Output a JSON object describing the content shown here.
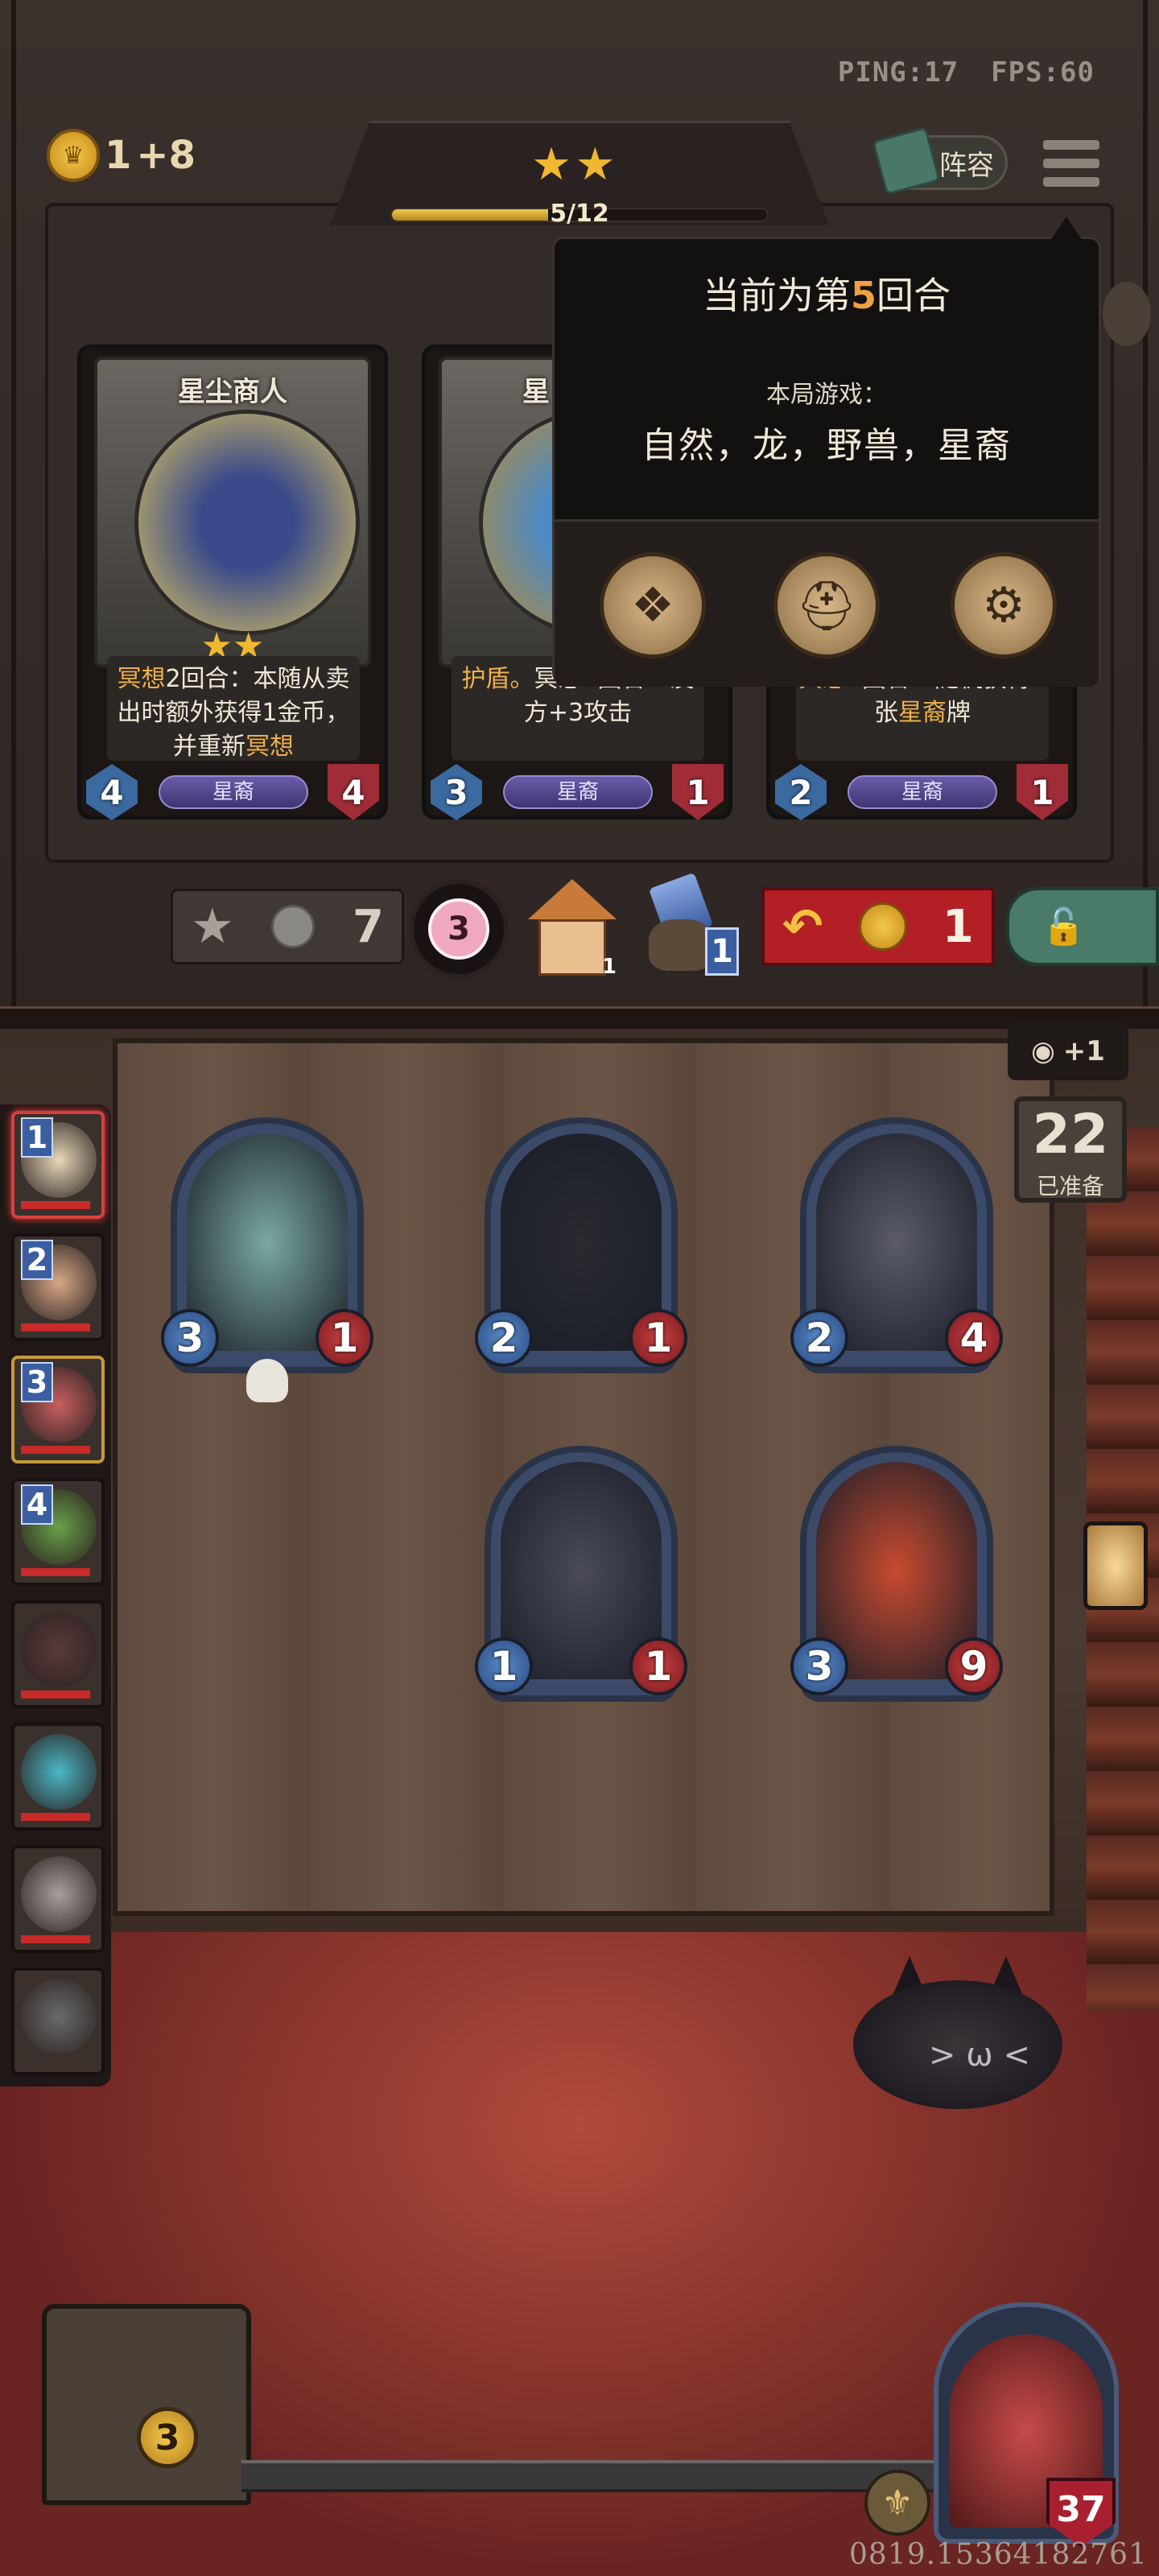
{
  "status": {
    "ping": "PING:17",
    "fps": "FPS:60"
  },
  "gold": {
    "amount": "1",
    "income": "+8"
  },
  "tier": {
    "stars": "★★",
    "progress_text": "5/12",
    "progress": 0.4167
  },
  "lineup_button": {
    "label": "阵容"
  },
  "shop_cards": [
    {
      "name": "星尘商人",
      "stars": "★★",
      "desc_pre": "冥想",
      "desc_mid": "2回合：本随从卖出时额外获得1金币，并重新",
      "desc_hl2": "冥想",
      "tribe": "星裔",
      "attack": "4",
      "health": "4"
    },
    {
      "name": "星",
      "stars": "",
      "desc_pre": "护盾。",
      "desc_mid": "冥想2回合：友方+3攻击",
      "desc_hl2": "",
      "tribe": "星裔",
      "attack": "3",
      "health": "1"
    },
    {
      "name": "",
      "stars": "",
      "desc_pre": "冥想",
      "desc_mid": "2回合：随机获得1张",
      "desc_hl2": "星裔",
      "desc_post": "牌",
      "tribe": "星裔",
      "attack": "2",
      "health": "1"
    }
  ],
  "action_bar": {
    "upgrade_cost": "7",
    "flower_count": "3",
    "house_count": "1",
    "potion_count": "1",
    "refresh_cost": "1"
  },
  "popup": {
    "title_pre": "当前为第",
    "round": "5",
    "title_post": "回合",
    "subtitle": "本局游戏：",
    "tribes": "自然，龙，野兽，星裔",
    "buttons": [
      "book-icon",
      "helmet-icon",
      "gear-icon"
    ]
  },
  "players": [
    {
      "rank": "1",
      "face_color": "#e8d8b8",
      "hp": 0.9
    },
    {
      "rank": "2",
      "face_color": "#d8a888",
      "hp": 0.9
    },
    {
      "rank": "3",
      "face_color": "#c86060",
      "hp": 0.9
    },
    {
      "rank": "4",
      "face_color": "#6aa048",
      "hp": 0.9
    },
    {
      "rank": "",
      "face_color": "#5a3a3a",
      "hp": 0.9
    },
    {
      "rank": "",
      "face_color": "#4ab8c8",
      "hp": 0.9
    },
    {
      "rank": "",
      "face_color": "#a8a0a0",
      "hp": 0.9
    },
    {
      "rank": "",
      "face_color": "#6a6a6a",
      "hp": 0.0
    }
  ],
  "ready": {
    "income": "+1",
    "count": "22",
    "label": "已准备"
  },
  "board": [
    {
      "art": "#7aa8a0",
      "attack": "3",
      "health": "1",
      "skull": true
    },
    {
      "art": "#2a2a30",
      "attack": "2",
      "health": "1",
      "skull": false
    },
    {
      "art": "#5a5a68",
      "attack": "2",
      "health": "4",
      "skull": false
    },
    {
      "art": "#4a4a58",
      "attack": "1",
      "health": "1",
      "skull": false
    },
    {
      "art": "#c84a30",
      "attack": "3",
      "health": "9",
      "skull": false
    }
  ],
  "tavern_level": "3",
  "hero": {
    "health": "37"
  },
  "uid": "0819.15364182761"
}
